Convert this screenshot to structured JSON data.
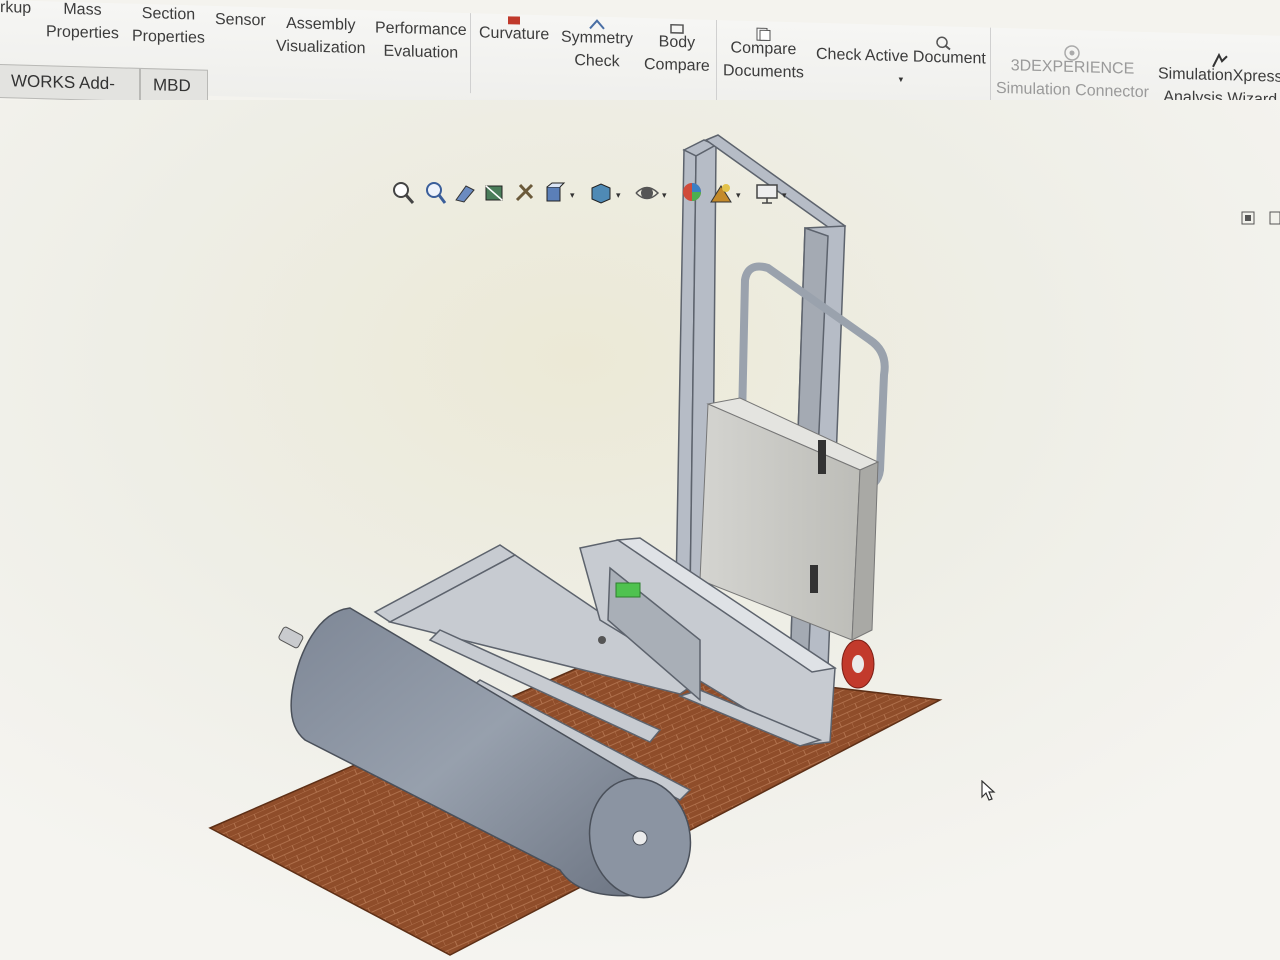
{
  "ribbon": {
    "items": [
      {
        "id": "markup",
        "label": "rkup",
        "label2": ""
      },
      {
        "id": "mass",
        "label": "Mass",
        "label2": "Properties"
      },
      {
        "id": "section",
        "label": "Section",
        "label2": "Properties"
      },
      {
        "id": "sensor",
        "label": "Sensor",
        "label2": ""
      },
      {
        "id": "asmviz",
        "label": "Assembly",
        "label2": "Visualization"
      },
      {
        "id": "perf",
        "label": "Performance",
        "label2": "Evaluation"
      },
      {
        "id": "curv",
        "label": "Curvature",
        "label2": ""
      },
      {
        "id": "sym",
        "label": "Symmetry",
        "label2": "Check"
      },
      {
        "id": "body",
        "label": "Body",
        "label2": "Compare"
      },
      {
        "id": "cmpdoc",
        "label": "Compare",
        "label2": "Documents"
      },
      {
        "id": "chk",
        "label": "Check Active Document",
        "label2": ""
      },
      {
        "id": "3dx",
        "label": "3DEXPERIENCE",
        "label2": "Simulation Connector"
      },
      {
        "id": "simx",
        "label": "SimulationXpress",
        "label2": "Analysis Wizard"
      }
    ]
  },
  "tabs": [
    "WORKS Add-Ins",
    "MBD"
  ],
  "headsup": {
    "icons": [
      "zoom-to-fit-icon",
      "zoom-to-area-icon",
      "previous-view-icon",
      "section-view-icon",
      "dynamic-annotation-icon",
      "view-orientation-icon",
      "display-style-icon",
      "hide-show-items-icon",
      "edit-appearance-icon",
      "apply-scene-icon",
      "view-settings-icon"
    ]
  },
  "colors": {
    "floor": "#8a4a28",
    "frame": "#b3b9c4",
    "roll": "#8a93a1",
    "wheel": "#c0392b",
    "green": "#4fc24f"
  }
}
